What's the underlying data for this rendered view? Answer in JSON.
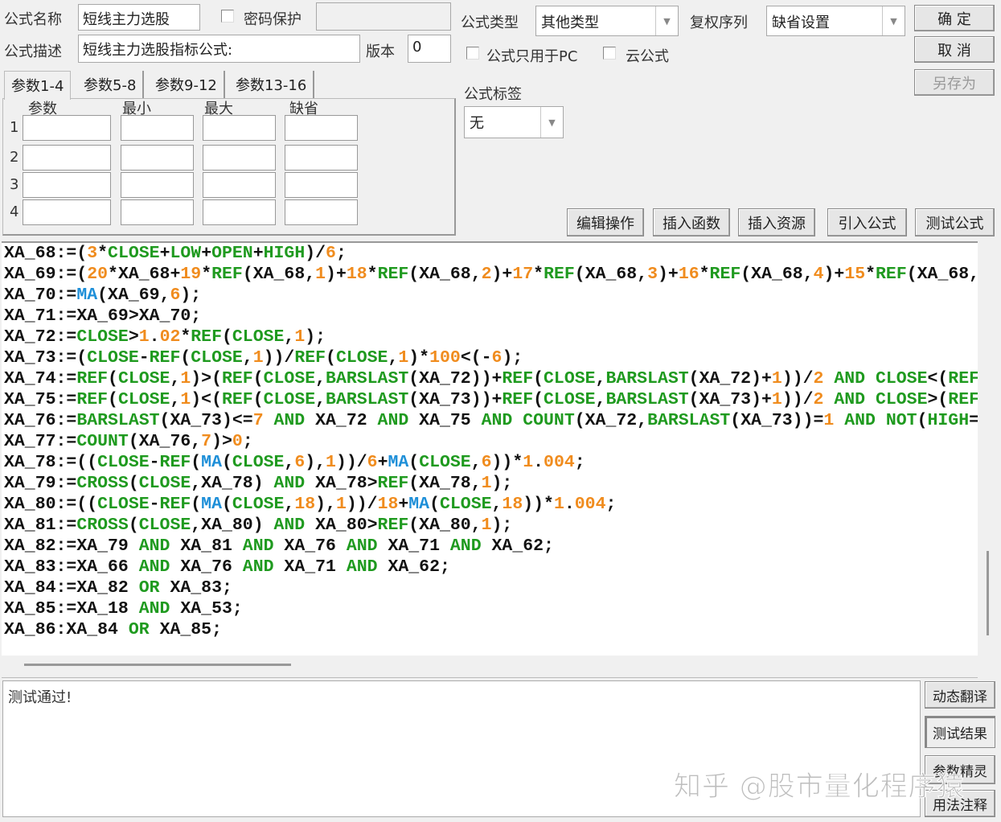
{
  "header": {
    "name_label": "公式名称",
    "name_value": "短线主力选股",
    "password_label": "密码保护",
    "password_checked": false,
    "password_value": "",
    "desc_label": "公式描述",
    "desc_value": "短线主力选股指标公式:",
    "version_label": "版本",
    "version_value": "0",
    "type_label": "公式类型",
    "type_value": "其他类型",
    "adjust_label": "复权序列",
    "adjust_value": "缺省设置",
    "pc_only_label": "公式只用于PC",
    "pc_only_checked": false,
    "cloud_label": "云公式",
    "cloud_checked": false,
    "tag_label": "公式标签",
    "tag_value": "无"
  },
  "buttons": {
    "ok": "确  定",
    "cancel": "取  消",
    "save_as": "另存为",
    "edit": "编辑操作",
    "insert_func": "插入函数",
    "insert_res": "插入资源",
    "import": "引入公式",
    "test": "测试公式"
  },
  "params": {
    "tabs": [
      "参数1-4",
      "参数5-8",
      "参数9-12",
      "参数13-16"
    ],
    "active_tab": 0,
    "columns": [
      "参数",
      "最小",
      "最大",
      "缺省"
    ],
    "rows": [
      "1",
      "2",
      "3",
      "4"
    ]
  },
  "code_lines": [
    "XA_68:=(3*CLOSE+LOW+OPEN+HIGH)/6;",
    "XA_69:=(20*XA_68+19*REF(XA_68,1)+18*REF(XA_68,2)+17*REF(XA_68,3)+16*REF(XA_68,4)+15*REF(XA_68,",
    "XA_70:=MA(XA_69,6);",
    "XA_71:=XA_69>XA_70;",
    "XA_72:=CLOSE>1.02*REF(CLOSE,1);",
    "XA_73:=(CLOSE-REF(CLOSE,1))/REF(CLOSE,1)*100<(-6);",
    "XA_74:=REF(CLOSE,1)>(REF(CLOSE,BARSLAST(XA_72))+REF(CLOSE,BARSLAST(XA_72)+1))/2 AND CLOSE<(REF",
    "XA_75:=REF(CLOSE,1)<(REF(CLOSE,BARSLAST(XA_73))+REF(CLOSE,BARSLAST(XA_73)+1))/2 AND CLOSE>(REF",
    "XA_76:=BARSLAST(XA_73)<=7 AND XA_72 AND XA_75 AND COUNT(XA_72,BARSLAST(XA_73))=1 AND NOT(HIGH=",
    "XA_77:=COUNT(XA_76,7)>0;",
    "XA_78:=((CLOSE-REF(MA(CLOSE,6),1))/6+MA(CLOSE,6))*1.004;",
    "XA_79:=CROSS(CLOSE,XA_78) AND XA_78>REF(XA_78,1);",
    "XA_80:=((CLOSE-REF(MA(CLOSE,18),1))/18+MA(CLOSE,18))*1.004;",
    "XA_81:=CROSS(CLOSE,XA_80) AND XA_80>REF(XA_80,1);",
    "XA_82:=XA_79 AND XA_81 AND XA_76 AND XA_71 AND XA_62;",
    "XA_83:=XA_66 AND XA_76 AND XA_71 AND XA_62;",
    "XA_84:=XA_82 OR XA_83;",
    "XA_85:=XA_18 AND XA_53;",
    "XA_86:XA_84 OR XA_85;"
  ],
  "syntax_colors": {
    "function": "#1f9a1f",
    "number": "#f08c1e",
    "ma": "#1e8fd8",
    "identifier": "#111111"
  },
  "status": {
    "message": "测试通过!"
  },
  "side_buttons": {
    "translate": "动态翻译",
    "result": "测试结果",
    "wizard": "参数精灵",
    "usage": "用法注释",
    "active": "测试结果"
  },
  "watermark": "知乎 @股市量化程序猿"
}
